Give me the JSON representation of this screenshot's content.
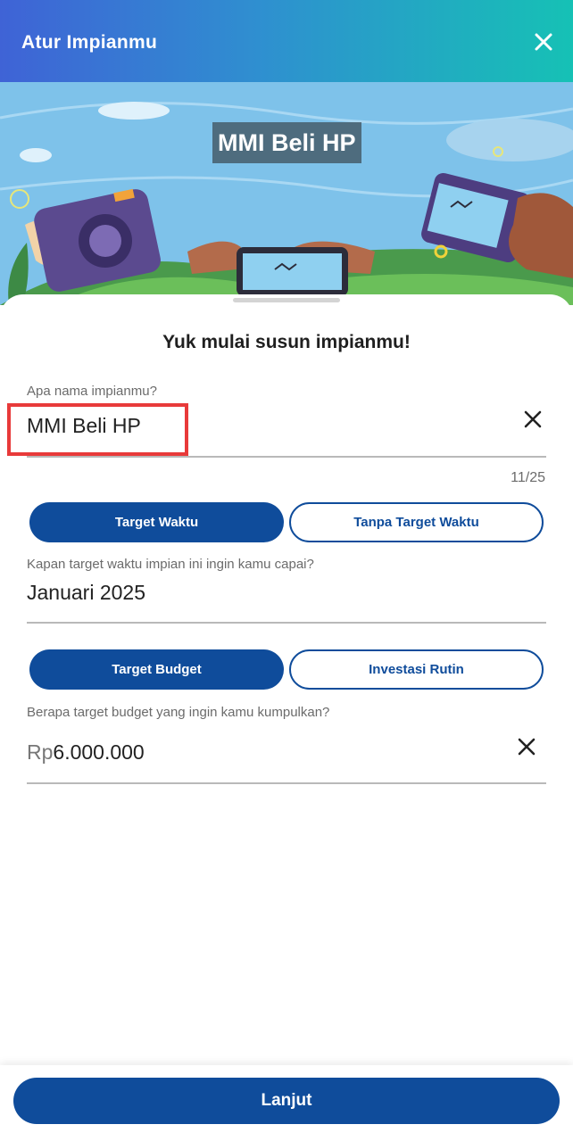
{
  "header": {
    "title": "Atur Impianmu",
    "close_icon": "close-icon"
  },
  "banner": {
    "title": "MMI Beli HP"
  },
  "form": {
    "heading": "Yuk mulai susun impianmu!",
    "name_label": "Apa nama impianmu?",
    "name_value": "MMI Beli HP",
    "name_counter": "11/25",
    "time_tabs": {
      "active": "Target Waktu",
      "inactive": "Tanpa Target Waktu"
    },
    "time_label": "Kapan target waktu impian ini ingin kamu capai?",
    "time_value": "Januari 2025",
    "budget_tabs": {
      "active": "Target Budget",
      "inactive": "Investasi Rutin"
    },
    "budget_label": "Berapa target budget yang ingin kamu kumpulkan?",
    "budget_prefix": "Rp",
    "budget_value": "6.000.000"
  },
  "footer": {
    "next_label": "Lanjut"
  },
  "colors": {
    "primary": "#0f4c9b",
    "highlight": "#e83a3a"
  }
}
